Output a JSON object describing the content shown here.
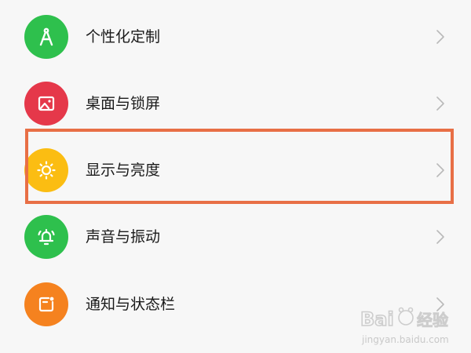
{
  "settings": {
    "items": [
      {
        "label": "个性化定制",
        "icon": "compass-icon",
        "color": "#2ec04d"
      },
      {
        "label": "桌面与锁屏",
        "icon": "image-icon",
        "color": "#e5384a"
      },
      {
        "label": "显示与亮度",
        "icon": "sun-icon",
        "color": "#fbbd12",
        "highlighted": true
      },
      {
        "label": "声音与振动",
        "icon": "bell-icon",
        "color": "#2ec04d"
      },
      {
        "label": "通知与状态栏",
        "icon": "notification-icon",
        "color": "#f5821f"
      }
    ]
  },
  "highlight": {
    "color": "#e86f46"
  },
  "watermark": {
    "brand": "Baidu经验",
    "url": "jingyan.baidu.com"
  }
}
